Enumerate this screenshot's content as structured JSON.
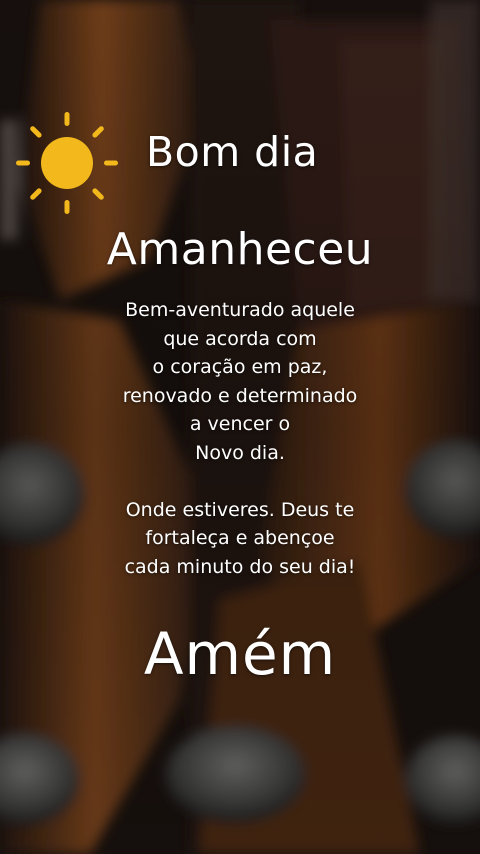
{
  "greeting": "Bom dia",
  "headline": "Amanheceu",
  "message_lines": [
    "Bem-aventurado aquele",
    "que acorda com",
    "o coração em paz,",
    "renovado e determinado",
    "a vencer o",
    "Novo dia."
  ],
  "blessing_lines": [
    "Onde estiveres. Deus te",
    "fortaleça e abençoe",
    "cada minuto do seu dia!"
  ],
  "closing": "Amém",
  "icons": {
    "sun": "sun-icon"
  },
  "colors": {
    "sun": "#f2b81c",
    "text": "#ffffff",
    "background_dark": "#1a1412",
    "background_wood": "#8a4a1f"
  }
}
